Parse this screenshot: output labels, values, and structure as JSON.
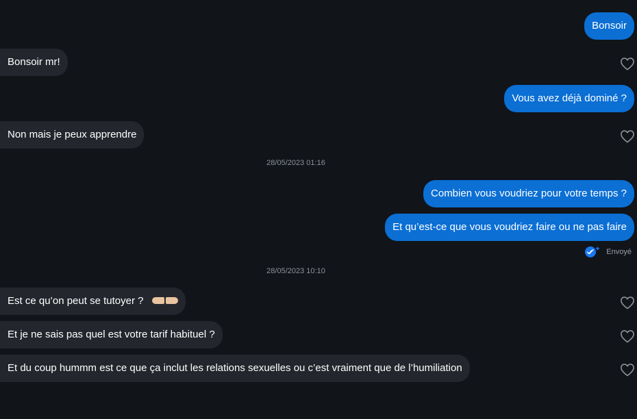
{
  "messages": [
    {
      "id": "m1",
      "dir": "out",
      "text": "Bonsoir"
    },
    {
      "id": "m2",
      "dir": "in",
      "text": "Bonsoir mr!"
    },
    {
      "id": "m3",
      "dir": "out",
      "text": "Vous avez déjà dominé ?"
    },
    {
      "id": "m4",
      "dir": "in",
      "text": "Non mais je peux apprendre"
    },
    {
      "id": "m5",
      "dir": "out",
      "text": "Combien vous voudriez pour votre temps ?"
    },
    {
      "id": "m6",
      "dir": "out",
      "text": "Et qu’est-ce que vous voudriez faire ou ne pas faire"
    },
    {
      "id": "m7",
      "dir": "in",
      "text": "Est ce qu’on peut se tutoyer ?",
      "emoji": "pointing-hands"
    },
    {
      "id": "m8",
      "dir": "in",
      "text": "Et je ne sais pas quel est votre tarif habituel ?"
    },
    {
      "id": "m9",
      "dir": "in",
      "text": "Et du coup hummm est ce que ça inclut les relations sexuelles ou c’est vraiment que de l’humiliation"
    }
  ],
  "timestamps": [
    "28/05/2023 01:16",
    "28/05/2023 10:10"
  ],
  "status": {
    "label": "Envoyé",
    "icon": "double-check-icon"
  },
  "colors": {
    "background": "#111419",
    "incoming": "#23262d",
    "outgoing": "#0b6fd4",
    "accent": "#1877f2"
  },
  "icons": {
    "like": "heart-outline-icon"
  }
}
